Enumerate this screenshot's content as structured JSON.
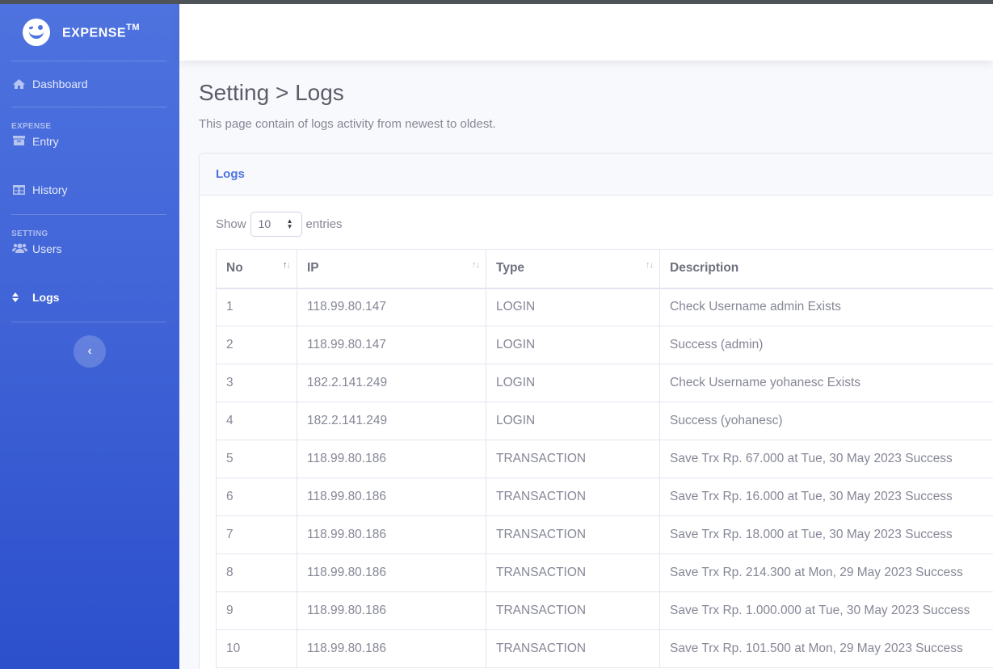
{
  "brand": {
    "name": "EXPENSE",
    "mark": "TM"
  },
  "sidebar": {
    "dashboard": "Dashboard",
    "heading_expense": "EXPENSE",
    "entry": "Entry",
    "history": "History",
    "heading_setting": "SETTING",
    "users": "Users",
    "logs": "Logs",
    "toggle": "‹"
  },
  "page": {
    "title": "Setting > Logs",
    "description": "This page contain of logs activity from newest to oldest."
  },
  "card": {
    "title": "Logs"
  },
  "length_menu": {
    "show": "Show",
    "value": "10",
    "entries": "entries"
  },
  "table": {
    "headers": [
      "No",
      "IP",
      "Type",
      "Description"
    ],
    "rows": [
      [
        "1",
        "118.99.80.147",
        "LOGIN",
        "Check Username admin Exists"
      ],
      [
        "2",
        "118.99.80.147",
        "LOGIN",
        "Success (admin)"
      ],
      [
        "3",
        "182.2.141.249",
        "LOGIN",
        "Check Username yohanesc Exists"
      ],
      [
        "4",
        "182.2.141.249",
        "LOGIN",
        "Success (yohanesc)"
      ],
      [
        "5",
        "118.99.80.186",
        "TRANSACTION",
        "Save Trx Rp. 67.000 at Tue, 30 May 2023 Success"
      ],
      [
        "6",
        "118.99.80.186",
        "TRANSACTION",
        "Save Trx Rp. 16.000 at Tue, 30 May 2023 Success"
      ],
      [
        "7",
        "118.99.80.186",
        "TRANSACTION",
        "Save Trx Rp. 18.000 at Tue, 30 May 2023 Success"
      ],
      [
        "8",
        "118.99.80.186",
        "TRANSACTION",
        "Save Trx Rp. 214.300 at Mon, 29 May 2023 Success"
      ],
      [
        "9",
        "118.99.80.186",
        "TRANSACTION",
        "Save Trx Rp. 1.000.000 at Tue, 30 May 2023 Success"
      ],
      [
        "10",
        "118.99.80.186",
        "TRANSACTION",
        "Save Trx Rp. 101.500 at Mon, 29 May 2023 Success"
      ]
    ]
  },
  "colors": {
    "primary": "#4e73df",
    "text": "#858796",
    "heading": "#5a5c69"
  }
}
